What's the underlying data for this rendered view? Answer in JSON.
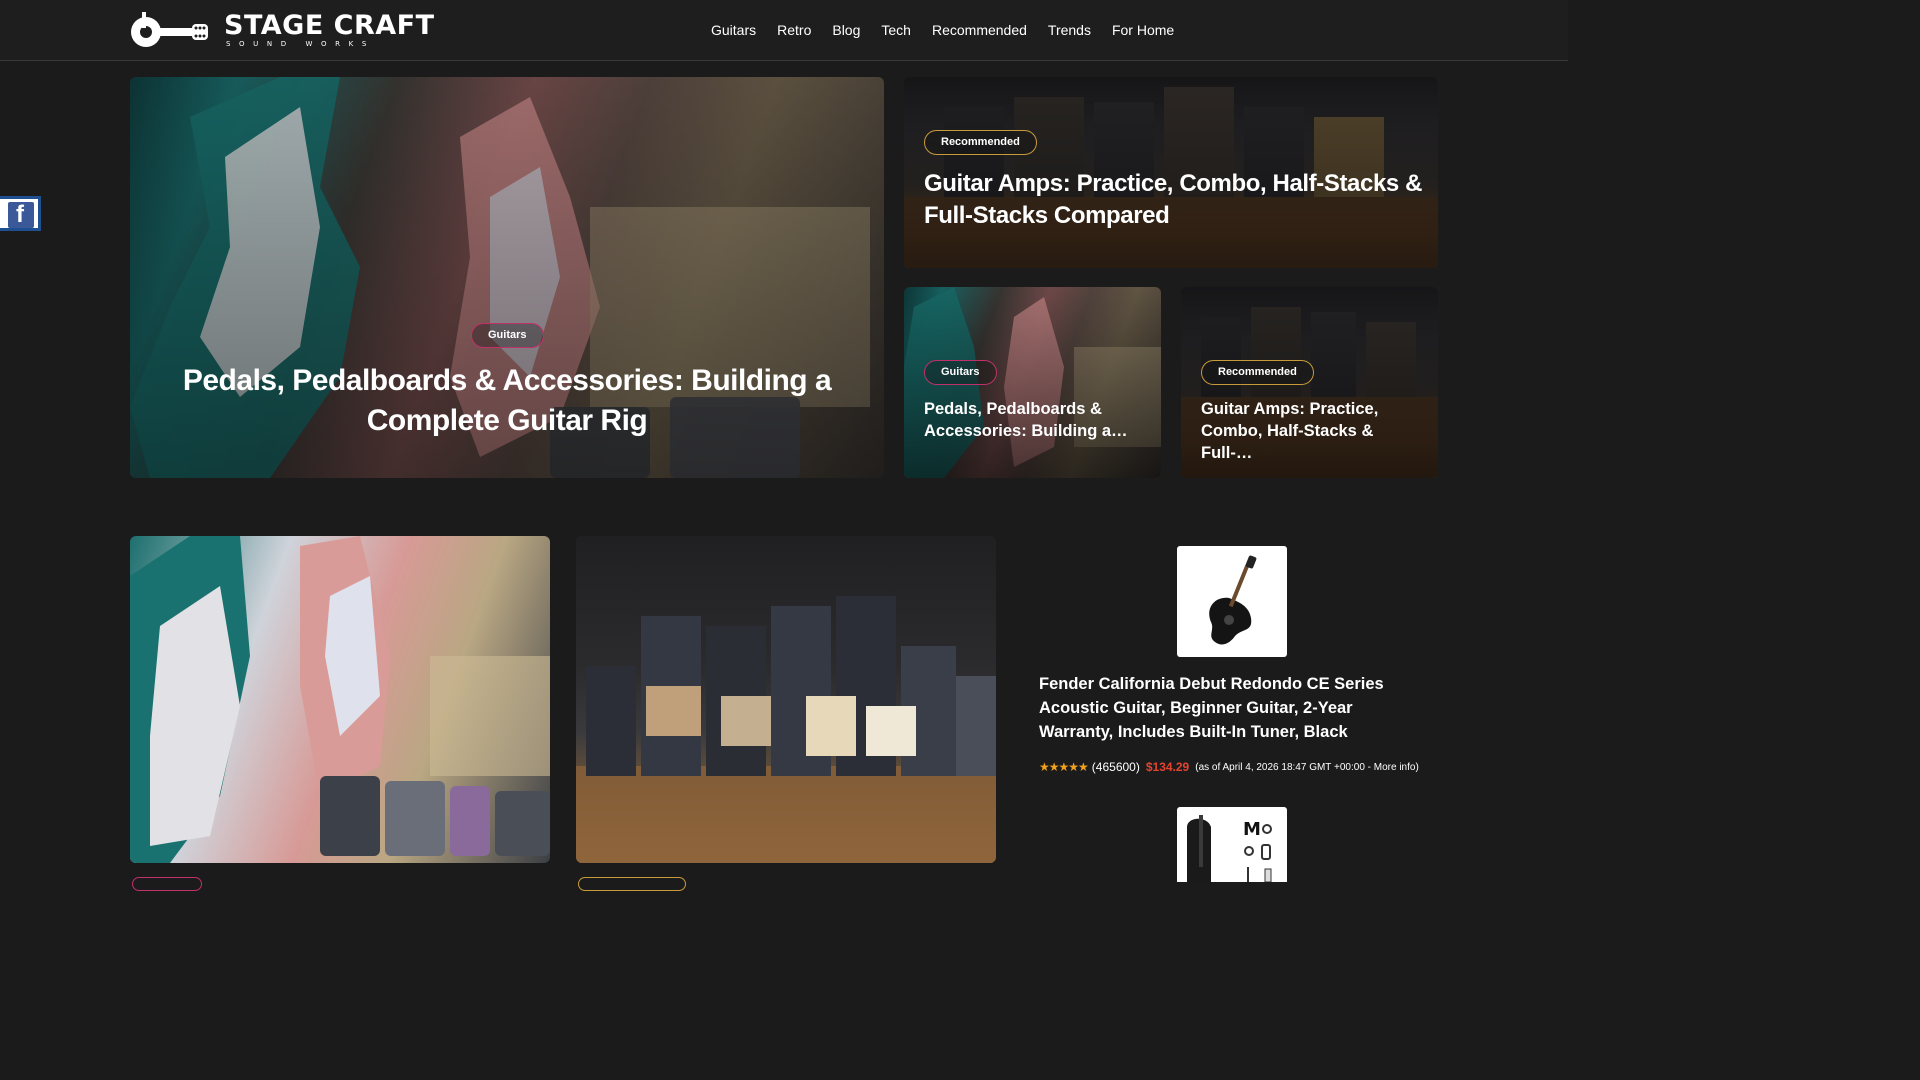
{
  "logo": {
    "title": "STAGE CRAFT",
    "subtitle": "SOUND WORKS"
  },
  "nav": [
    "Guitars",
    "Retro",
    "Blog",
    "Tech",
    "Recommended",
    "Trends",
    "For Home"
  ],
  "social": {
    "facebook_glyph": "f"
  },
  "hero": {
    "main": {
      "category": "Guitars",
      "title": "Pedals, Pedalboards & Accessories: Building a Complete Guitar Rig"
    },
    "top_right": {
      "category": "Recommended",
      "title": "Guitar Amps: Practice, Combo, Half-Stacks & Full-Stacks Compared"
    },
    "small_left": {
      "category": "Guitars",
      "title": "Pedals, Pedalboards & Accessories: Building a…"
    },
    "small_right": {
      "category": "Recommended",
      "title": "Guitar Amps: Practice, Combo, Half-Stacks & Full-…"
    }
  },
  "product": {
    "title": "Fender California Debut Redondo CE Series Acoustic Guitar, Beginner Guitar, 2-Year Warranty, Includes Built-In Tuner, Black",
    "stars": "★★★★★",
    "reviews": "(465600)",
    "price": "$134.29",
    "as_of": "(as of April 4, 2026 18:47 GMT +00:00 - More info)"
  },
  "colors": {
    "background": "#1b1b1b",
    "accent_pink": "#c0306a",
    "accent_gold": "#c79a3a",
    "price_red": "#e5432f",
    "star": "#f0a020"
  }
}
